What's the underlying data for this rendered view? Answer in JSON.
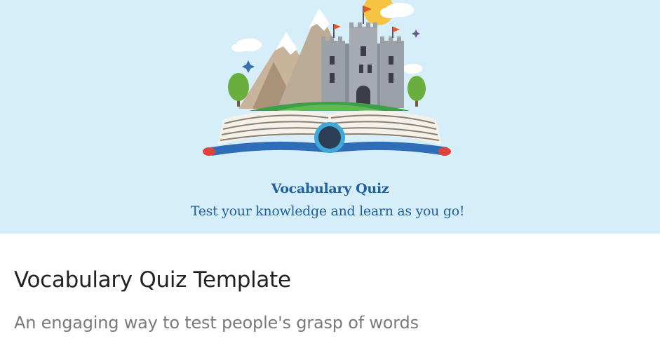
{
  "banner": {
    "title": "Vocabulary Quiz",
    "subtitle": "Test your knowledge and learn as you go!",
    "illustration": "open-book-castle-illustration",
    "background_color": "#d6eef9",
    "text_color": "#1f5f9e"
  },
  "card": {
    "title": "Vocabulary Quiz Template",
    "description": "An engaging way to test people's grasp of words"
  }
}
